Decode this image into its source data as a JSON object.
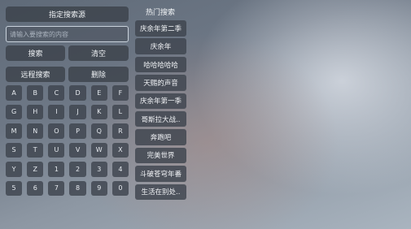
{
  "source_button": "指定搜索源",
  "search": {
    "placeholder": "请输入要搜索的内容"
  },
  "search_button": "搜索",
  "clear_button": "清空",
  "remote_search_button": "远程搜索",
  "delete_button": "删除",
  "keys": [
    "A",
    "B",
    "C",
    "D",
    "E",
    "F",
    "G",
    "H",
    "I",
    "J",
    "K",
    "L",
    "M",
    "N",
    "O",
    "P",
    "Q",
    "R",
    "S",
    "T",
    "U",
    "V",
    "W",
    "X",
    "Y",
    "Z",
    "1",
    "2",
    "3",
    "4",
    "5",
    "6",
    "7",
    "8",
    "9",
    "0"
  ],
  "hot": {
    "title": "热门搜索",
    "items": [
      "庆余年第二季",
      "庆余年",
      "哈哈哈哈哈",
      "天赐的声音",
      "庆余年第一季",
      "哥斯拉大战..",
      "奔跑吧",
      "完美世界",
      "斗破苍穹年番",
      "生活在别处.."
    ]
  }
}
